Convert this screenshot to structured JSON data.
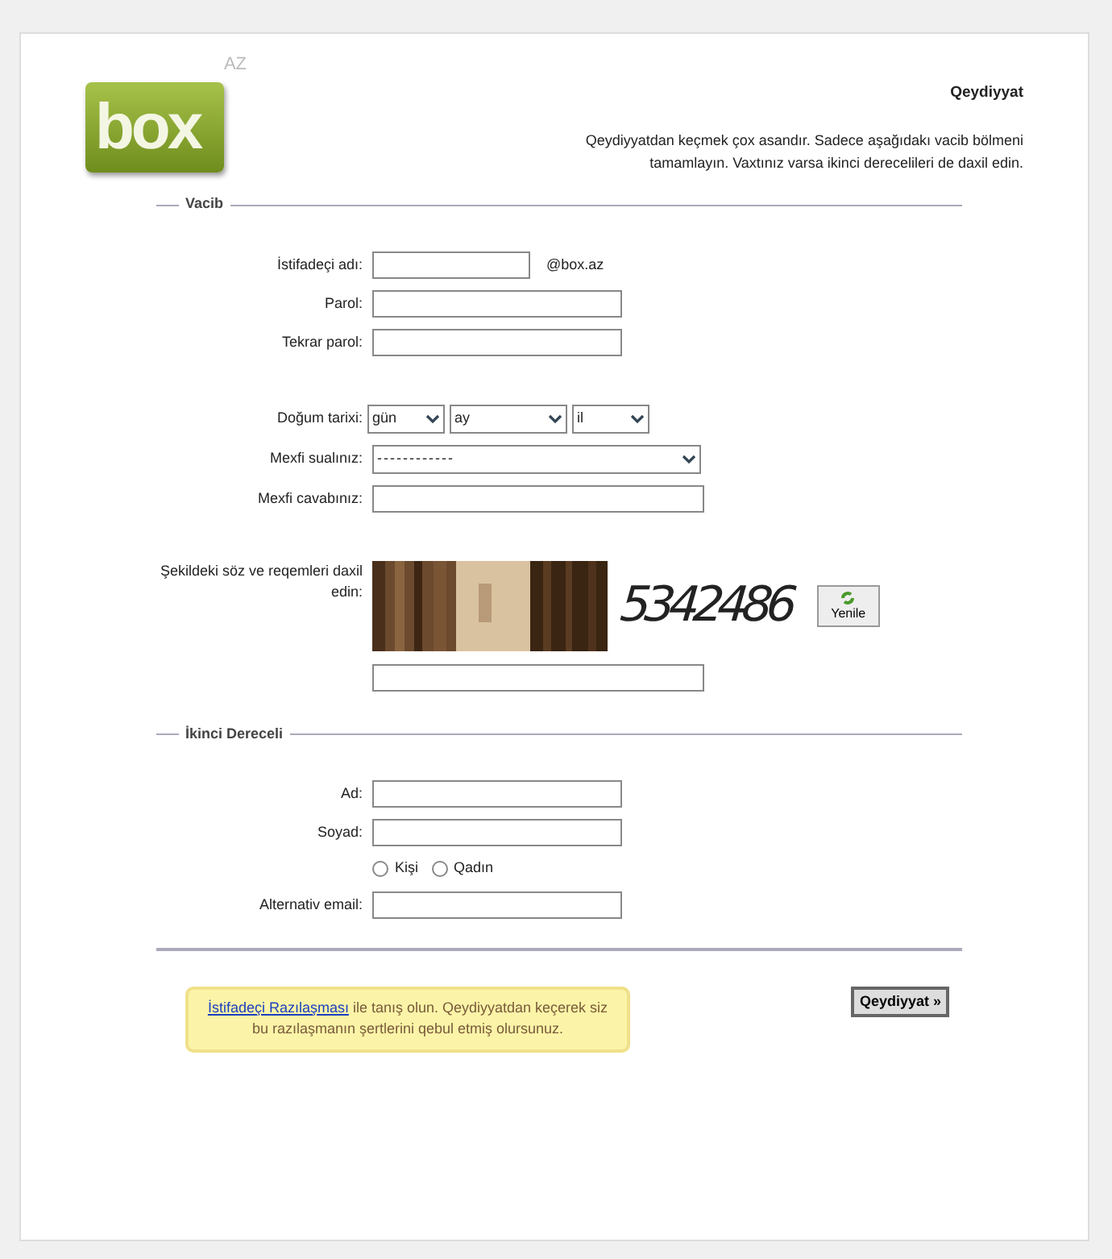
{
  "logo": {
    "text": "box",
    "suffix": "AZ"
  },
  "header": {
    "title": "Qeydiyyat",
    "intro": "Qeydiyyatdan keçmek çox asandır. Sadece aşağıdakı vacib bölmeni tamamlayın. Vaxtınız varsa ikinci derecelileri de daxil edin."
  },
  "required": {
    "legend": "Vacib",
    "fields": [
      {
        "kind": "text",
        "label": "İstifadeçi adı:",
        "suffix": "@box.az"
      },
      {
        "kind": "password",
        "label": "Parol:"
      },
      {
        "kind": "password",
        "label": "Tekrar parol:"
      },
      {
        "kind": "date",
        "label": "Doğum tarixi:",
        "selects": [
          {
            "value": "gün"
          },
          {
            "value": "ay"
          },
          {
            "value": "il"
          }
        ]
      },
      {
        "kind": "select",
        "label": "Mexfi sualınız:",
        "value": "------------"
      },
      {
        "kind": "text",
        "label": "Mexfi cavabınız:"
      }
    ],
    "captcha": {
      "label": "Şekildeki söz ve reqemleri daxil edin:",
      "code": "5342486",
      "refresh": "Yenile"
    }
  },
  "optional": {
    "legend": "İkinci Dereceli",
    "fields": [
      {
        "kind": "text",
        "label": "Ad:"
      },
      {
        "kind": "text",
        "label": "Soyad:"
      },
      {
        "kind": "radio",
        "options": [
          {
            "label": "Kişi",
            "selected": false
          },
          {
            "label": "Qadın",
            "selected": false
          }
        ]
      },
      {
        "kind": "text",
        "label": "Alternativ email:"
      }
    ]
  },
  "agreement": {
    "link": "İstifadeçi Razılaşması",
    "text": " ile tanış olun. Qeydiyyatdan keçerek siz bu razılaşmanın şertlerini qebul etmiş olursunuz."
  },
  "submit": "Qeydiyyat »"
}
